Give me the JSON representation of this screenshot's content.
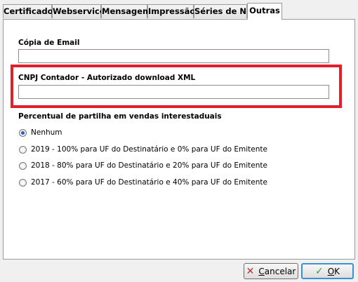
{
  "tabs": [
    {
      "label": "Certificado"
    },
    {
      "label": "Webservice"
    },
    {
      "label": "Mensagem"
    },
    {
      "label": "Impressão"
    },
    {
      "label": "Séries de NFe"
    },
    {
      "label": "Outras"
    }
  ],
  "active_tab": "Outras",
  "form": {
    "copia_email_label": "Cópia de  Email",
    "copia_email_value": "",
    "cnpj_contador_label": "CNPJ Contador - Autorizado download XML",
    "cnpj_contador_value": "",
    "partilha_label": "Percentual de partilha em vendas interestaduais",
    "partilha_options": [
      {
        "label": "Nenhum",
        "checked": true
      },
      {
        "label": "2019 - 100% para UF do Destinatário e 0% para UF do Emitente",
        "checked": false
      },
      {
        "label": "2018 - 80% para UF do Destinatário e 20% para UF do Emitente",
        "checked": false
      },
      {
        "label": "2017 - 60% para UF do Destinatário e 40% para UF do Emitente",
        "checked": false
      }
    ]
  },
  "buttons": {
    "cancel_label_first": "C",
    "cancel_label_rest": "ancelar",
    "ok_label_first": "O",
    "ok_label_rest": "K"
  },
  "colors": {
    "highlight": "#e0202a",
    "cancel_icon": "#c0282e",
    "ok_icon": "#3aa23a"
  }
}
